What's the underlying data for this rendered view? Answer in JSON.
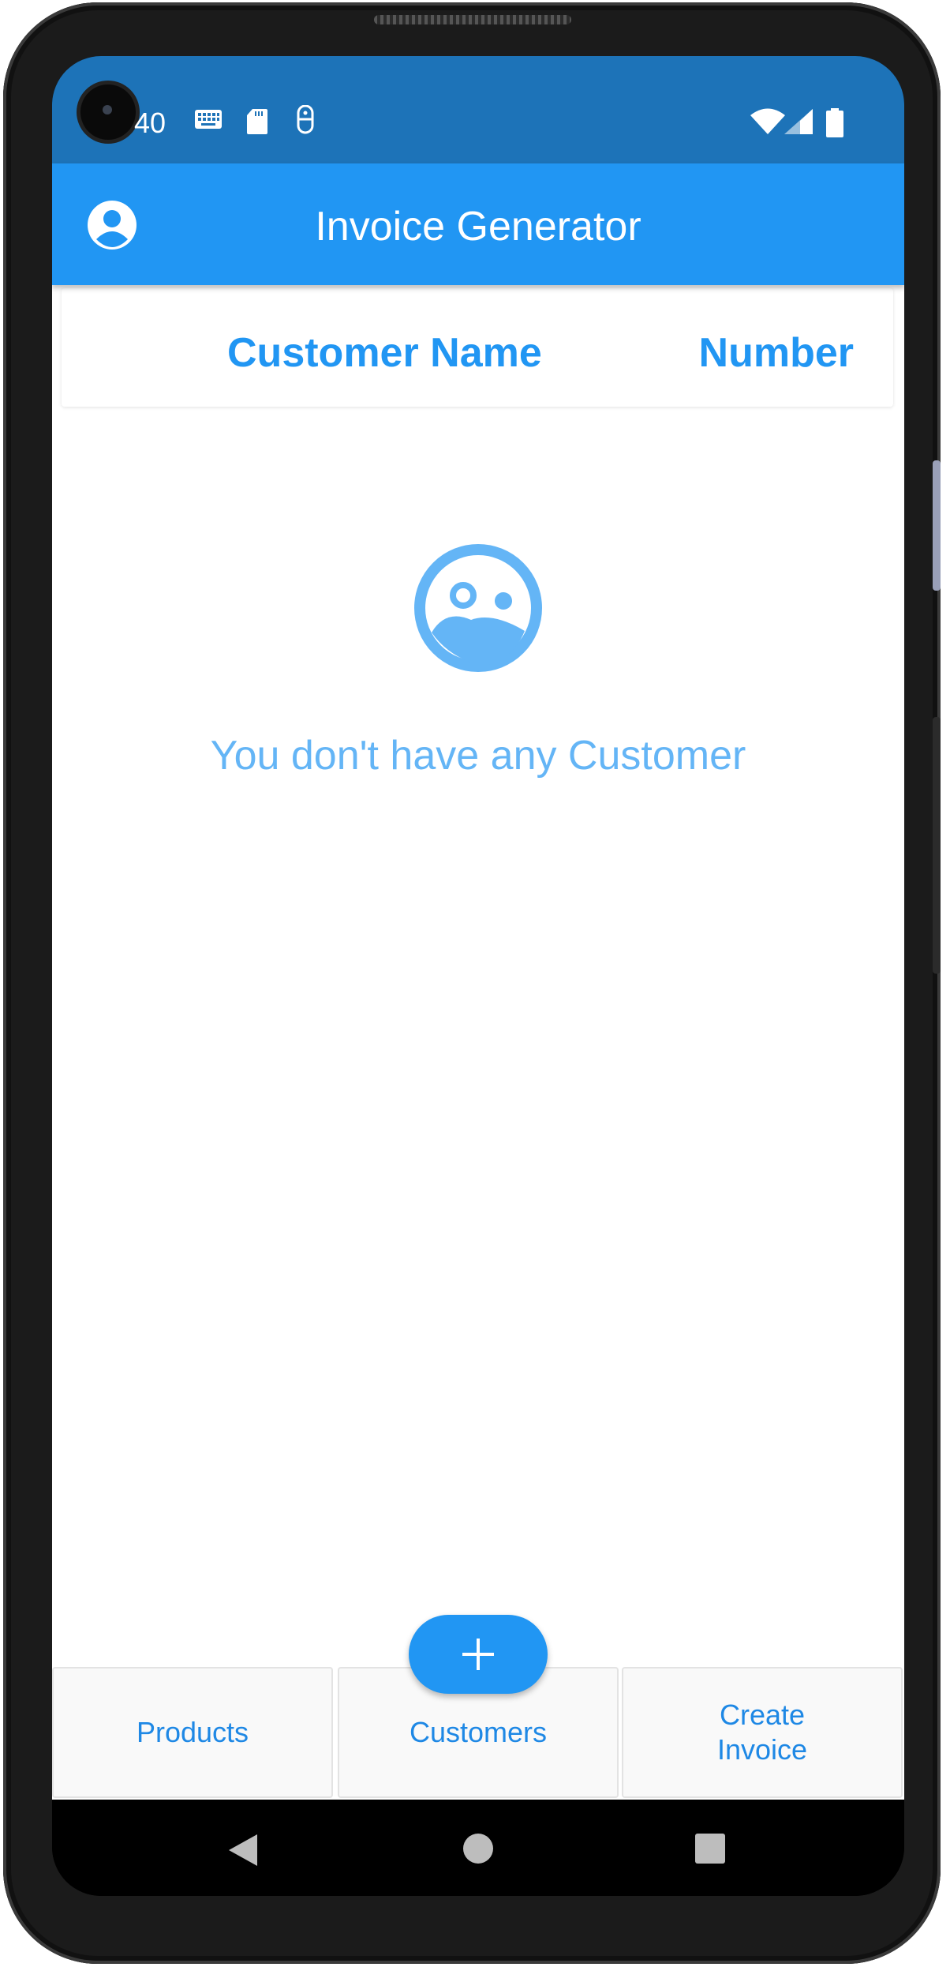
{
  "status_bar": {
    "time": "40",
    "icons": [
      "keyboard-icon",
      "sd-card-icon",
      "accessibility-icon",
      "wifi-icon",
      "signal-icon",
      "battery-icon"
    ]
  },
  "app_bar": {
    "title": "Invoice Generator",
    "profile_icon": "account-circle-icon"
  },
  "table_header": {
    "name_label": "Customer Name",
    "number_label": "Number"
  },
  "empty_state": {
    "icon": "sad-face-icon",
    "message": "You don't have any Customer"
  },
  "fab": {
    "icon": "plus-icon"
  },
  "bottom_nav": {
    "items": [
      {
        "label": "Products"
      },
      {
        "label": "Customers"
      },
      {
        "label": "Create\nInvoice"
      }
    ]
  },
  "system_nav": {
    "icons": [
      "back-icon",
      "home-icon",
      "recents-icon"
    ]
  },
  "colors": {
    "primary": "#2196f3",
    "status_bar": "#1d73b8",
    "empty_accent": "#64b5f6",
    "nav_text": "#1e88e5"
  }
}
